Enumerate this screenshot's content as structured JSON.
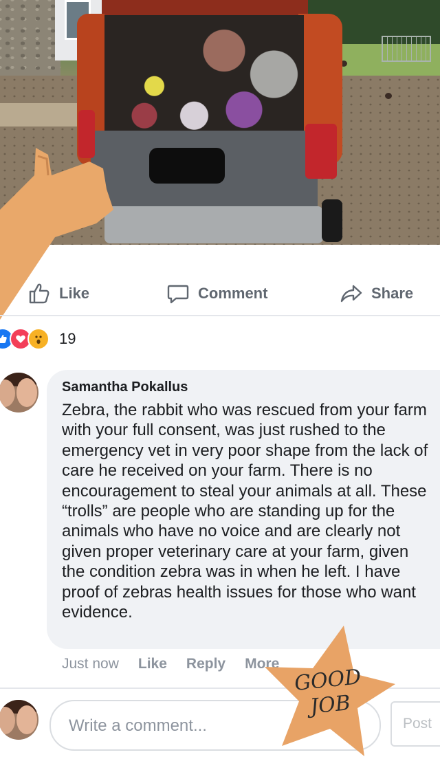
{
  "post": {
    "actions": {
      "like": "Like",
      "comment": "Comment",
      "share": "Share"
    },
    "reactions": {
      "types": [
        "like",
        "love",
        "wow"
      ],
      "count": "19"
    }
  },
  "comment": {
    "author": "Samantha Pokallus",
    "text": "Zebra, the rabbit who was rescued from your farm with your full consent, was just rushed to the emergency vet in very poor shape from the lack of care he received on your farm. There is no encouragement to steal your animals at all. These “trolls” are people who are standing up for the animals who have no voice and are clearly not given proper veterinary care at your farm, given the condition zebra was in when he left. I have proof of zebras health issues for those who want evidence.",
    "time": "Just now",
    "like": "Like",
    "reply": "Reply",
    "more": "More"
  },
  "composer": {
    "placeholder": "Write a comment...",
    "post": "Post"
  },
  "sticker": {
    "line1": "GOOD",
    "line2": "JOB"
  },
  "colors": {
    "accent": "#1877f2",
    "love": "#f33e58",
    "wow": "#f7b125",
    "sticker": "#e8a366"
  }
}
